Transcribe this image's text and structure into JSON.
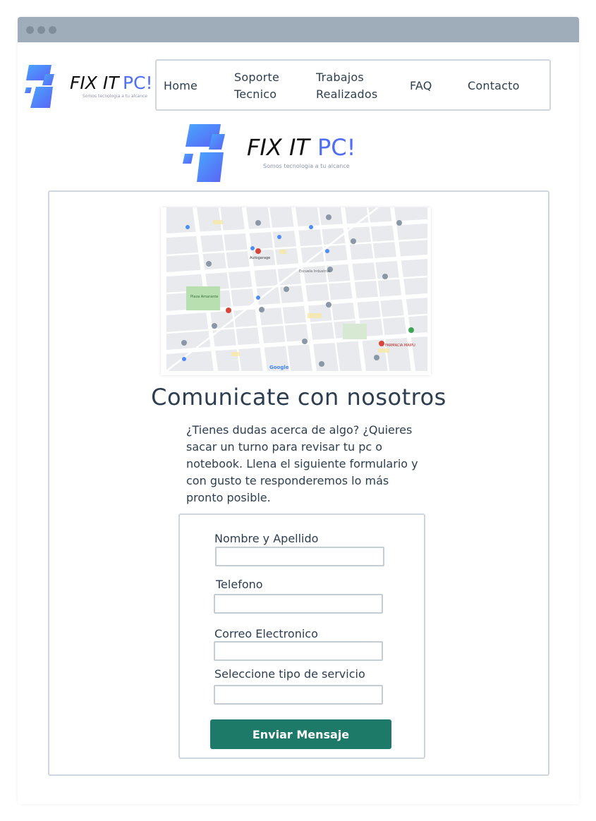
{
  "logo": {
    "brand_dark": "FIX IT",
    "brand_accent": "PC!",
    "tagline": "Somos tecnologia a tu alcance",
    "colors": {
      "dark": "#111111",
      "accent": "#4d6ef5",
      "tile_light": "#4aa3ff",
      "tile_dark": "#5566f5"
    }
  },
  "nav": {
    "items": [
      {
        "label": "Home"
      },
      {
        "label_line1": "Soporte",
        "label_line2": "Tecnico"
      },
      {
        "label_line1": "Trabajos",
        "label_line2": "Realizados"
      },
      {
        "label": "FAQ"
      },
      {
        "label": "Contacto"
      }
    ]
  },
  "map": {
    "places": [
      "Autogarage",
      "Plaza Amarante",
      "FARMACIA MAIPU",
      "Google",
      "Escuela Industrial"
    ]
  },
  "contact": {
    "heading": "Comunicate con nosotros",
    "intro_lines": [
      "¿Tienes dudas acerca de algo? ¿Quieres",
      "sacar un turno para revisar tu pc o",
      "notebook. Llena el siguiente formulario y",
      "con gusto te responderemos lo más",
      "pronto posible."
    ]
  },
  "form": {
    "fields": [
      {
        "label": "Nombre y Apellido",
        "value": ""
      },
      {
        "label": "Telefono",
        "value": ""
      },
      {
        "label": "Correo Electronico",
        "value": ""
      },
      {
        "label": "Seleccione tipo de servicio",
        "value": ""
      }
    ],
    "submit_label": "Enviar Mensaje",
    "submit_color": "#1e7a68"
  }
}
